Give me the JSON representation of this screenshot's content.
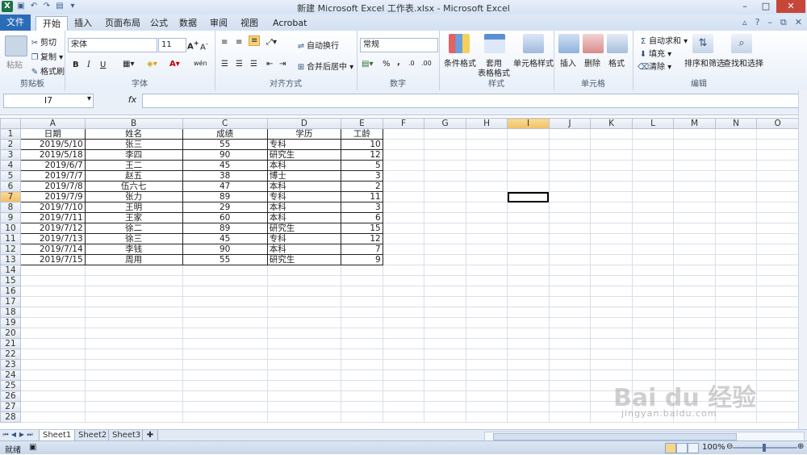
{
  "window": {
    "title": "新建 Microsoft Excel 工作表.xlsx - Microsoft Excel",
    "controls": [
      "–",
      "□",
      "✕"
    ]
  },
  "tabs": {
    "file": "文件",
    "items": [
      "开始",
      "插入",
      "页面布局",
      "公式",
      "数据",
      "审阅",
      "视图",
      "Acrobat"
    ],
    "active": "开始"
  },
  "ribbon": {
    "clipboard": {
      "paste": "粘贴",
      "cut": "剪切",
      "copy": "复制",
      "format_painter": "格式刷",
      "label": "剪贴板"
    },
    "font": {
      "name": "宋体",
      "size": "11",
      "bold": "B",
      "italic": "I",
      "underline": "U",
      "label": "字体",
      "wen": "wén"
    },
    "alignment": {
      "wrap": "自动换行",
      "merge": "合并后居中",
      "label": "对齐方式"
    },
    "number": {
      "format": "常规",
      "percent": "%",
      "comma": ",",
      "label": "数字"
    },
    "styles": {
      "conditional": "条件格式",
      "table_format_1": "套用",
      "table_format_2": "表格格式",
      "cell_styles": "单元格样式",
      "label": "样式"
    },
    "cells": {
      "insert": "插入",
      "delete": "删除",
      "format": "格式",
      "label": "单元格"
    },
    "editing": {
      "autosum": "自动求和",
      "fill": "填充",
      "clear": "清除",
      "sort": "排序和筛选",
      "find": "查找和选择",
      "label": "编辑"
    }
  },
  "formula_bar": {
    "name_box": "I7",
    "fx": "fx",
    "value": ""
  },
  "columns": [
    "A",
    "B",
    "C",
    "D",
    "E",
    "F",
    "G",
    "H",
    "I",
    "J",
    "K",
    "L",
    "M",
    "N",
    "O"
  ],
  "table": {
    "headers": [
      "日期",
      "姓名",
      "成绩",
      "学历",
      "工龄"
    ],
    "rows": [
      [
        "2019/5/10",
        "张三",
        "55",
        "专科",
        "10"
      ],
      [
        "2019/5/18",
        "李四",
        "90",
        "研究生",
        "12"
      ],
      [
        "2019/6/7",
        "王二",
        "45",
        "本科",
        "5"
      ],
      [
        "2019/7/7",
        "赵五",
        "38",
        "博士",
        "3"
      ],
      [
        "2019/7/8",
        "伍六七",
        "47",
        "本科",
        "2"
      ],
      [
        "2019/7/9",
        "张力",
        "89",
        "专科",
        "11"
      ],
      [
        "2019/7/10",
        "王明",
        "29",
        "本科",
        "3"
      ],
      [
        "2019/7/11",
        "王家",
        "60",
        "本科",
        "6"
      ],
      [
        "2019/7/12",
        "徐二",
        "89",
        "研究生",
        "15"
      ],
      [
        "2019/7/13",
        "徐三",
        "45",
        "专科",
        "12"
      ],
      [
        "2019/7/14",
        "李钱",
        "90",
        "本科",
        "7"
      ],
      [
        "2019/7/15",
        "周用",
        "55",
        "研究生",
        "9"
      ]
    ]
  },
  "row_count": 28,
  "active_cell": {
    "col": "I",
    "row": 7
  },
  "sheets": [
    "Sheet1",
    "Sheet2",
    "Sheet3"
  ],
  "active_sheet": "Sheet1",
  "status": {
    "mode": "就绪",
    "zoom": "100%"
  },
  "watermark": {
    "main": "Bai du 经验",
    "sub": "jingyan.baidu.com"
  }
}
